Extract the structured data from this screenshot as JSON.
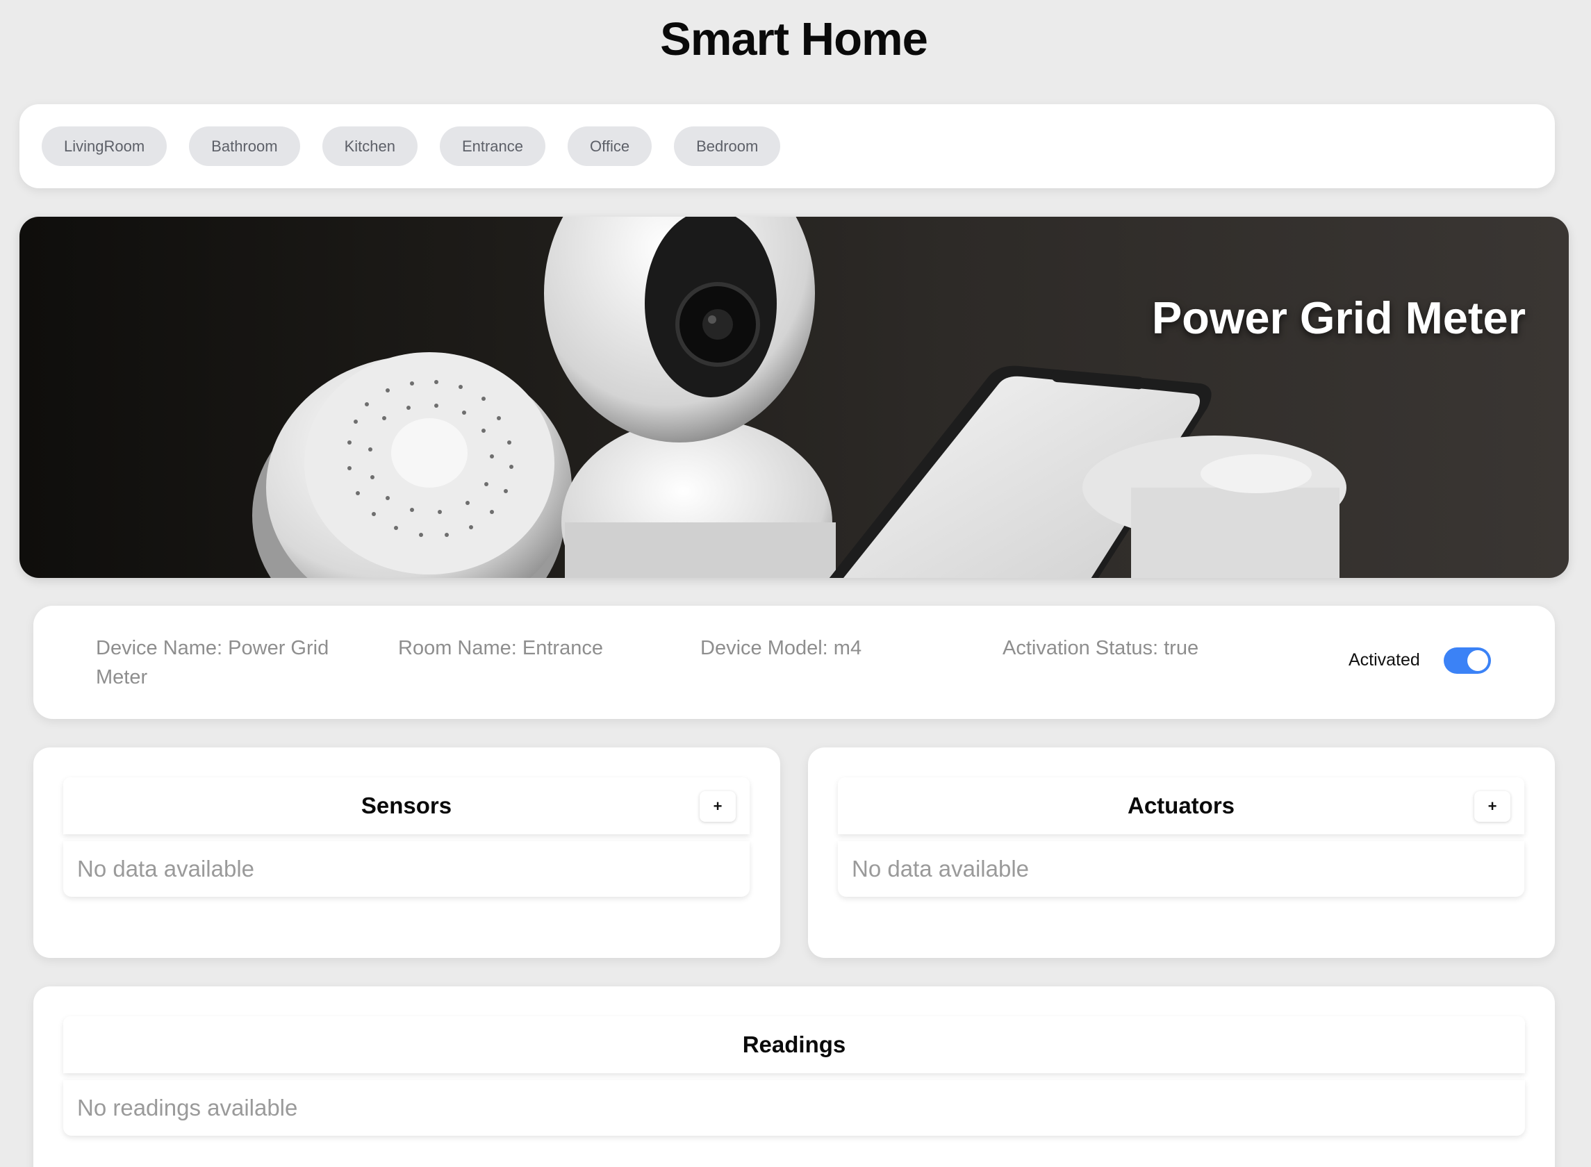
{
  "app": {
    "title": "Smart Home"
  },
  "rooms": [
    "LivingRoom",
    "Bathroom",
    "Kitchen",
    "Entrance",
    "Office",
    "Bedroom"
  ],
  "hero": {
    "title": "Power Grid Meter"
  },
  "device": {
    "name_text": "Device Name: Power Grid Meter",
    "room_text": "Room Name: Entrance",
    "model_text": "Device Model: m4",
    "status_text": "Activation Status: true",
    "toggle_label": "Activated",
    "toggle_on": true
  },
  "sensors": {
    "title": "Sensors",
    "add_label": "+",
    "empty": "No data available"
  },
  "actuators": {
    "title": "Actuators",
    "add_label": "+",
    "empty": "No data available"
  },
  "readings": {
    "title": "Readings",
    "empty": "No readings available"
  },
  "colors": {
    "accent": "#3b82f6",
    "background": "#ebebeb",
    "pill": "#e4e5e8"
  }
}
